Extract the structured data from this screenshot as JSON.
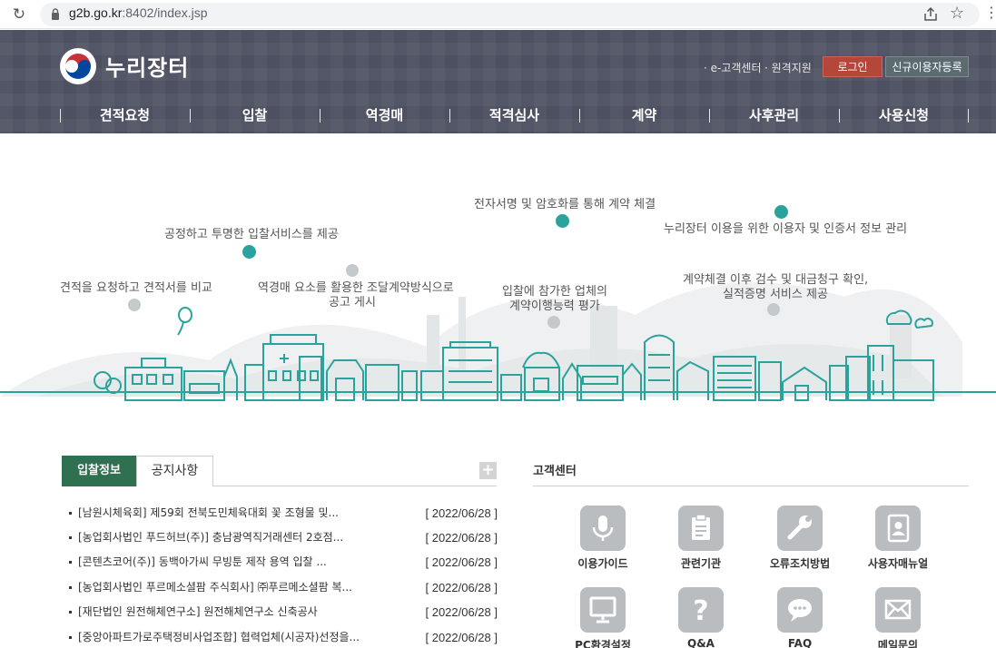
{
  "browser": {
    "url_host": "g2b.go.kr",
    "url_rest": ":8402/index.jsp"
  },
  "header": {
    "logo_text": "누리장터",
    "util_links": [
      "· e-고객센터",
      "· 원격지원"
    ],
    "login_label": "로그인",
    "register_label": "신규이용자등록",
    "gnb": [
      "견적요청",
      "입찰",
      "역경매",
      "적격심사",
      "계약",
      "사후관리",
      "사용신청"
    ]
  },
  "hero": {
    "captions": {
      "quote": "견적을 요청하고 견적서를 비교",
      "bid_fair": "공정하고 투명한 입찰서비스를 제공",
      "reverse_1": "역경매 요소를 활용한 조달계약방식으로",
      "reverse_2": "공고 게시",
      "esign": "전자서명 및 암호화를 통해 계약 체결",
      "evaluate_1": "입찰에 참가한 업체의",
      "evaluate_2": "계약이행능력 평가",
      "after_1": "계약체결 이후 검수 및 대금청구 확인,",
      "after_2": "실적증명 서비스 제공",
      "manage": "누리장터 이용을 위한 이용자 및 인증서 정보 관리"
    },
    "accent_color": "#2aa39c"
  },
  "board": {
    "tab_active": "입찰정보",
    "tab_other": "공지사항",
    "more": "+",
    "rows": [
      {
        "title": "[남원시체육회] 제59회 전북도민체육대회 꽃 조형물 및...",
        "date": "[ 2022/06/28 ]"
      },
      {
        "title": "[농업회사법인 푸드허브(주)] 충남광역직거래센터 2호점...",
        "date": "[ 2022/06/28 ]"
      },
      {
        "title": "[콘텐츠코어(주)] 동백아가씨 무빙툰 제작 용역 입찰 ...",
        "date": "[ 2022/06/28 ]"
      },
      {
        "title": "[농업회사법인 푸르메소셜팜 주식회사] ㈜푸르메소셜팜 복...",
        "date": "[ 2022/06/28 ]"
      },
      {
        "title": "[재단법인 원전해체연구소] 원전해체연구소 신축공사",
        "date": "[ 2022/06/28 ]"
      },
      {
        "title": "[중앙아파트가로주택정비사업조합] 협력업체(시공자)선정을...",
        "date": "[ 2022/06/28 ]"
      }
    ]
  },
  "customer_center": {
    "title": "고객센터",
    "items": [
      {
        "label": "이용가이드",
        "icon": "microphone-icon"
      },
      {
        "label": "관련기관",
        "icon": "clipboard-icon"
      },
      {
        "label": "오류조치방법",
        "icon": "wrench-icon"
      },
      {
        "label": "사용자매뉴얼",
        "icon": "user-manual-icon"
      },
      {
        "label": "PC환경설정",
        "icon": "monitor-icon"
      },
      {
        "label": "Q&A",
        "icon": "question-icon"
      },
      {
        "label": "FAQ",
        "icon": "chat-icon"
      },
      {
        "label": "메일문의",
        "icon": "mail-icon"
      }
    ]
  }
}
